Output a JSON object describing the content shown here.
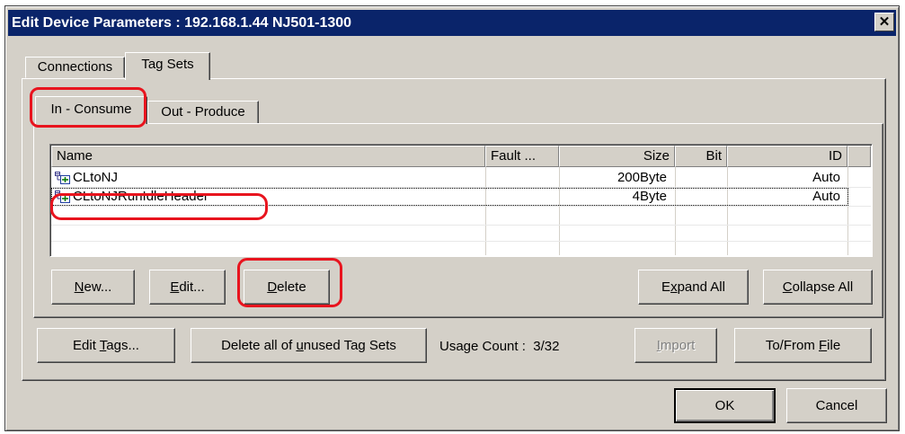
{
  "window": {
    "title": "Edit Device Parameters : 192.168.1.44 NJ501-1300",
    "close_glyph": "✕"
  },
  "tabs": {
    "connections": "Connections",
    "tag_sets": "Tag Sets"
  },
  "subtabs": {
    "in_consume": "In - Consume",
    "out_produce": "Out - Produce"
  },
  "table": {
    "columns": [
      "Name",
      "Fault ...",
      "Size",
      "Bit",
      "ID"
    ],
    "rows": [
      {
        "name": "CLtoNJ",
        "fault": "",
        "size": "200Byte",
        "bit": "",
        "id": "Auto",
        "icon": "tag-set-icon"
      },
      {
        "name": "CLtoNJRunIdleHeader",
        "fault": "",
        "size": "4Byte",
        "bit": "",
        "id": "Auto",
        "icon": "tag-set-icon"
      }
    ]
  },
  "buttons": {
    "new": {
      "before": "",
      "ul": "N",
      "after": "ew..."
    },
    "edit": {
      "before": "",
      "ul": "E",
      "after": "dit..."
    },
    "delete": {
      "before": "",
      "ul": "D",
      "after": "elete"
    },
    "expand_all": {
      "before": "E",
      "ul": "x",
      "after": "pand All"
    },
    "collapse_all": {
      "before": "",
      "ul": "C",
      "after": "ollapse All"
    },
    "edit_tags": {
      "before": "Edit ",
      "ul": "T",
      "after": "ags..."
    },
    "delete_unused": {
      "before": "Delete all of ",
      "ul": "u",
      "after": "nused Tag Sets"
    },
    "import": {
      "before": "",
      "ul": "I",
      "after": "mport"
    },
    "to_from_file": {
      "before": "To/From ",
      "ul": "F",
      "after": "ile"
    },
    "ok": "OK",
    "cancel": "Cancel"
  },
  "usage": {
    "label": "Usage Count :",
    "value": "3/32"
  },
  "colors": {
    "titlebar": "#0a246a",
    "face": "#d4d0c8",
    "annotation": "#e8141e"
  }
}
